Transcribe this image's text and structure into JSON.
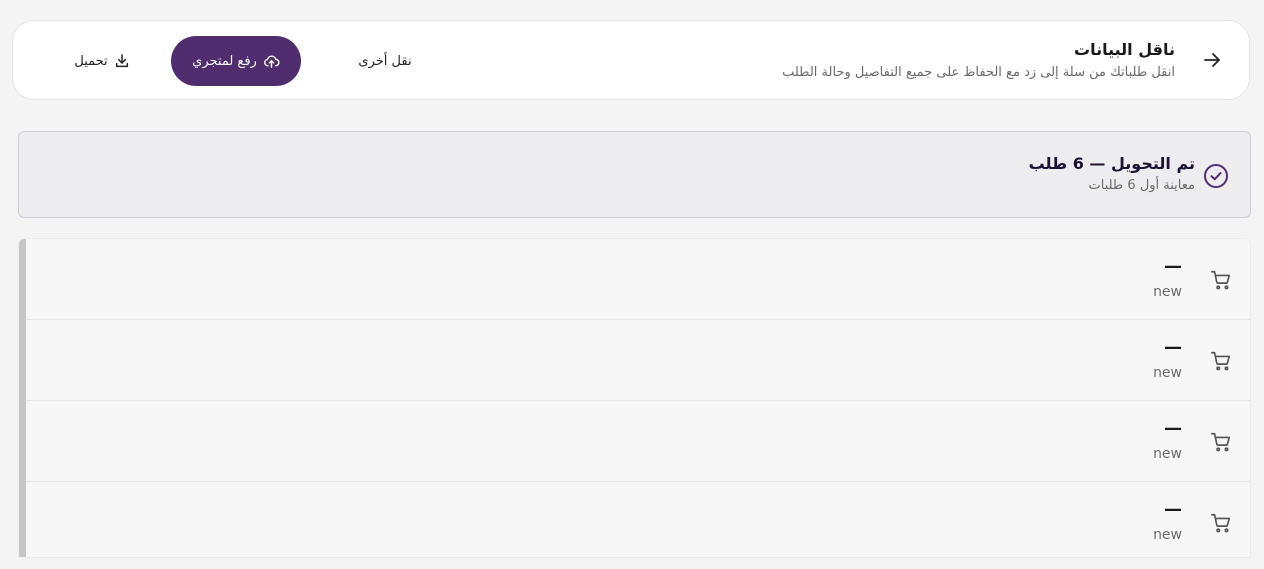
{
  "header": {
    "title": "ناقل البيانات",
    "subtitle": "انقل طلباتك من سلة إلى زد مع الحفاظ على جميع التفاصيل وحالة الطلب",
    "back_icon": "arrow-right-icon",
    "other_label": "نقل أخرى",
    "upload_label": "رفع لمتجري",
    "upload_icon": "cloud-upload-icon",
    "download_label": "تحميل",
    "download_icon": "download-icon",
    "accent_color": "#4f2d6e"
  },
  "status": {
    "title": "تم التحويل — 6 طلب",
    "subtitle": "معاينة أول 6 طلبات",
    "icon": "check-circle-icon"
  },
  "orders": [
    {
      "name": "—",
      "status": "new",
      "icon": "cart-icon"
    },
    {
      "name": "—",
      "status": "new",
      "icon": "cart-icon"
    },
    {
      "name": "—",
      "status": "new",
      "icon": "cart-icon"
    },
    {
      "name": "—",
      "status": "new",
      "icon": "cart-icon"
    }
  ]
}
